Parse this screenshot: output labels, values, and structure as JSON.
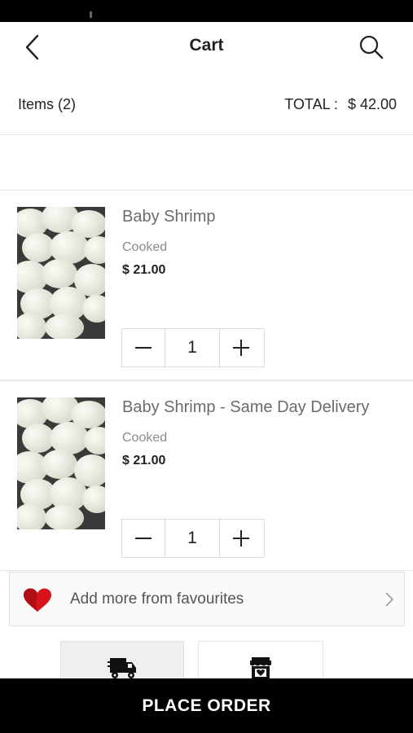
{
  "header": {
    "title": "Cart"
  },
  "summary": {
    "items_label": "Items (2)",
    "total_label": "TOTAL :",
    "total_value": "$ 42.00"
  },
  "cart": {
    "items": [
      {
        "name": "Baby Shrimp",
        "variant": "Cooked",
        "price": "$ 21.00",
        "quantity": "1"
      },
      {
        "name": "Baby Shrimp - Same Day Delivery",
        "variant": "Cooked",
        "price": "$ 21.00",
        "quantity": "1"
      }
    ]
  },
  "favourites": {
    "label": "Add more from favourites"
  },
  "footer": {
    "place_order": "PLACE ORDER"
  },
  "icons": {
    "back": "chevron-left-icon",
    "search": "search-icon",
    "minus": "minus-icon",
    "plus": "plus-icon",
    "heart": "heart-icon",
    "chevron": "chevron-right-icon",
    "delivery": "delivery-truck-icon",
    "store": "store-icon"
  },
  "colors": {
    "heart": "#d7141b",
    "place_order_bg": "#000000",
    "accent_text": "#222222"
  }
}
